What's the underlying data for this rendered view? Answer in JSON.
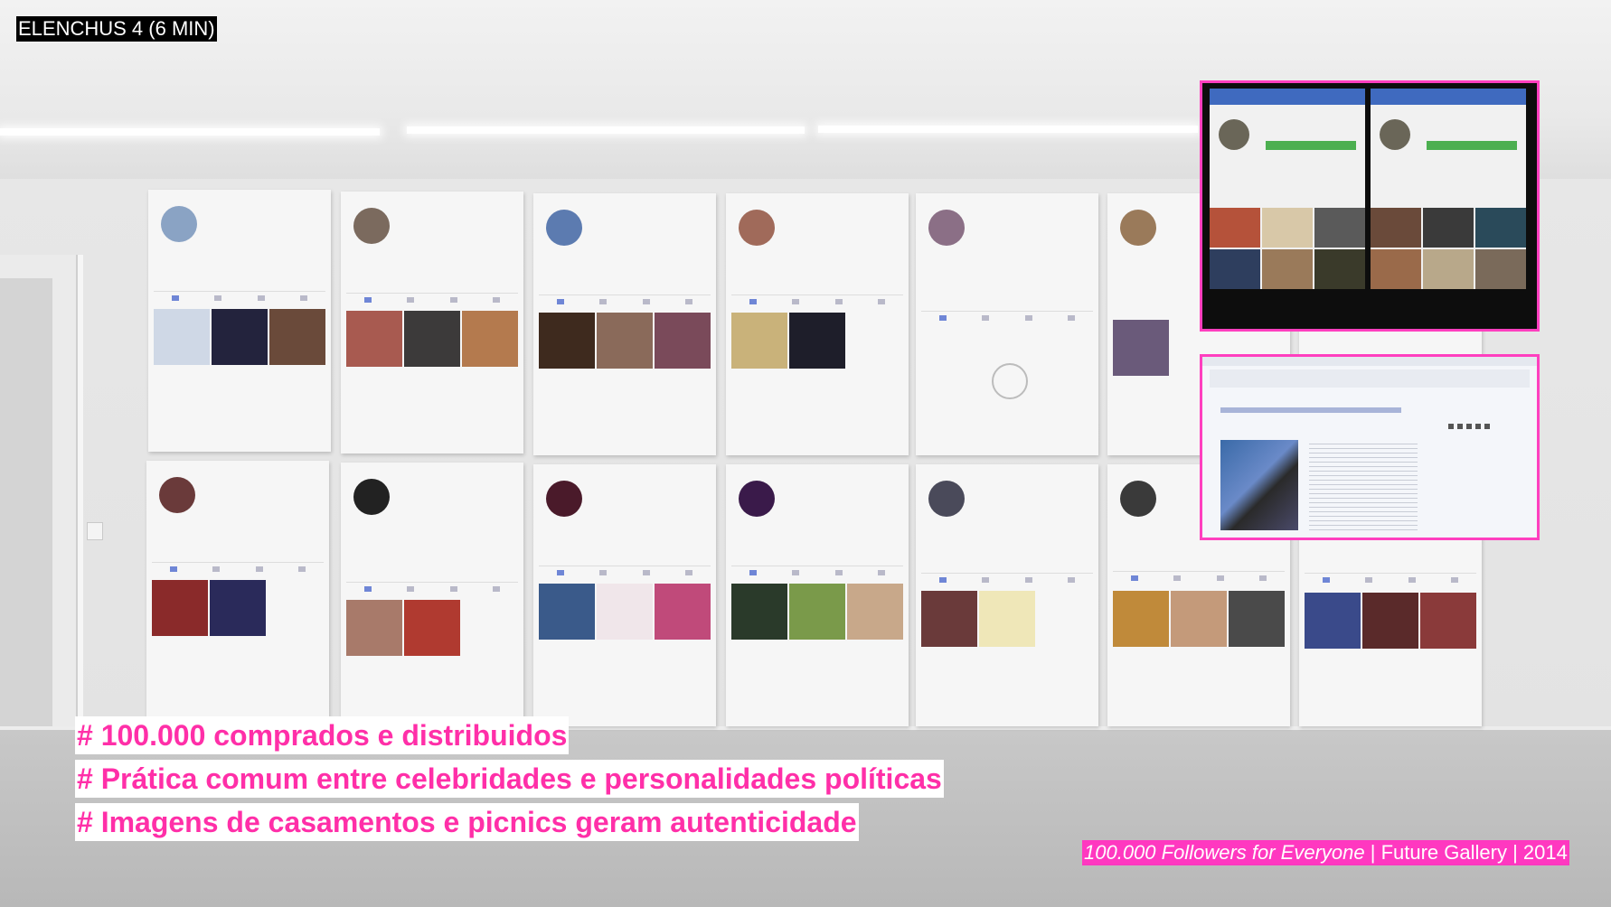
{
  "title": "ELENCHUS 4 (6 MIN)",
  "bullets": [
    "# 100.000 comprados e distribuidos",
    "# Prática comum entre celebridades e personalidades políticas",
    "# Imagens de casamentos e picnics geram autenticidade"
  ],
  "credit": {
    "work": "100.000 Followers for Everyone",
    "sep1": " | ",
    "venue": "Future Gallery",
    "sep2": " | ",
    "year": "2014"
  },
  "colors": {
    "accent_pink": "#ff38c0",
    "text_pink": "#ff2fa8",
    "title_bg": "#000000",
    "profile_blue": "#5b7fd1"
  },
  "icons": [
    "grid-icon",
    "list-icon",
    "location-icon",
    "person-tag-icon",
    "camera-icon"
  ]
}
